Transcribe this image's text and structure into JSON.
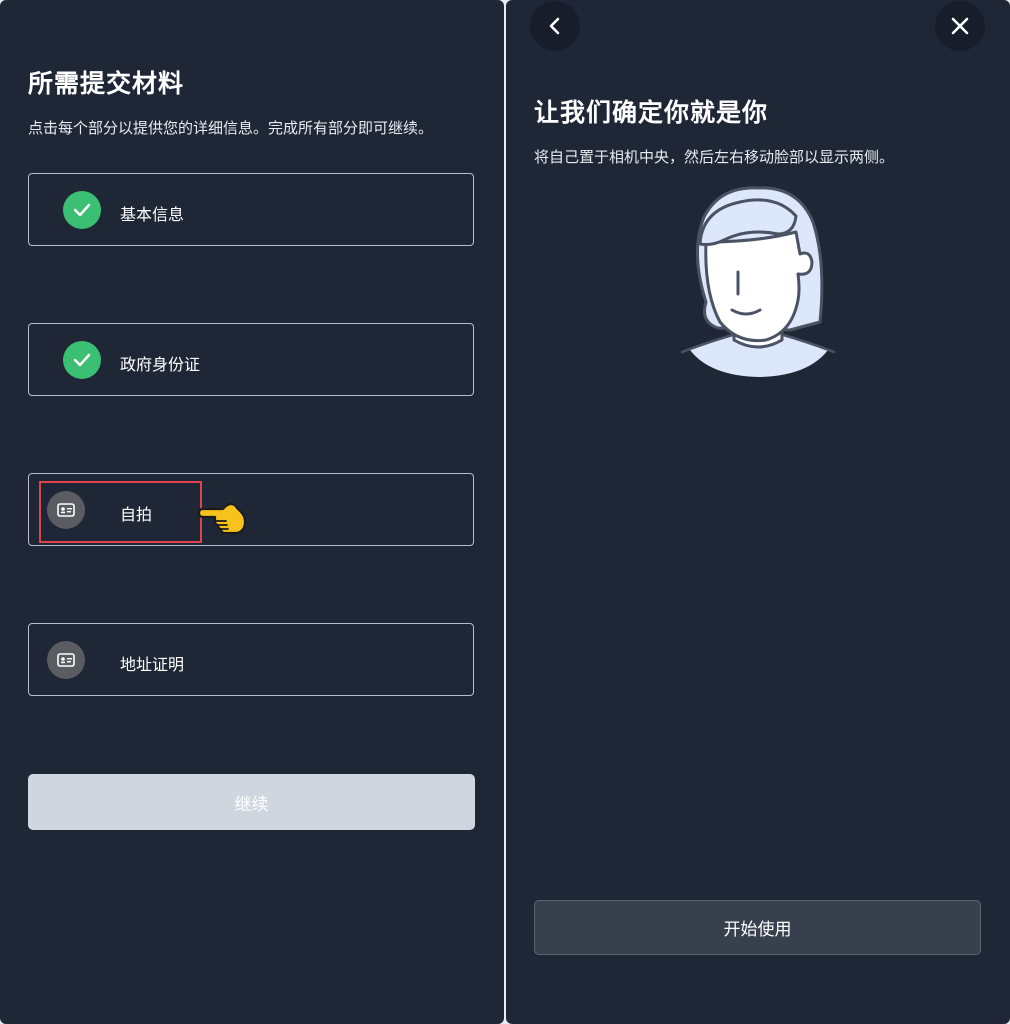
{
  "left": {
    "title": "所需提交材料",
    "subtitle": "点击每个部分以提供您的详细信息。完成所有部分即可继续。",
    "sections": [
      {
        "label": "基本信息",
        "status": "complete",
        "icon": "check-icon"
      },
      {
        "label": "政府身份证",
        "status": "complete",
        "icon": "check-icon"
      },
      {
        "label": "自拍",
        "status": "incomplete",
        "icon": "id-card-icon",
        "highlighted": true
      },
      {
        "label": "地址证明",
        "status": "incomplete",
        "icon": "id-card-icon"
      }
    ],
    "continue_label": "继续"
  },
  "right": {
    "back_icon": "chevron-left-icon",
    "close_icon": "close-icon",
    "title": "让我们确定你就是你",
    "subtitle": "将自己置于相机中央，然后左右移动脸部以显示两侧。",
    "illustration": "face-avatar-illustration",
    "start_label": "开始使用"
  },
  "colors": {
    "background": "#1f2737",
    "success": "#3bbf72",
    "pending": "#5a5c61",
    "highlight": "#e0444b",
    "disabled_button": "#d0d6e0",
    "avatar_fill": "#dce7fb"
  }
}
